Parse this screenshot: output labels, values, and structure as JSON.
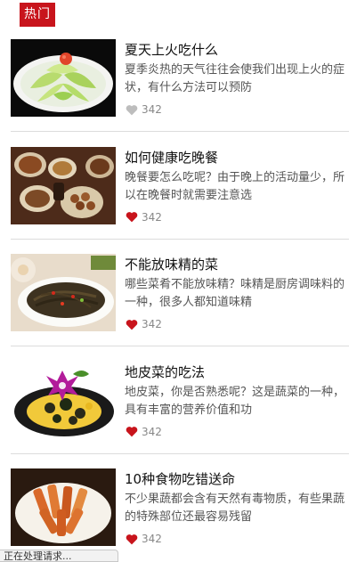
{
  "tab": {
    "label": "热门"
  },
  "articles": [
    {
      "title": "夏天上火吃什么",
      "desc": "夏季炎热的天气往往会使我们出现上火的症状，有什么方法可以预防",
      "likes": "342",
      "liked": false
    },
    {
      "title": "如何健康吃晚餐",
      "desc": "晚餐要怎么吃呢？由于晚上的活动量少，所以在晚餐时就需要注意选",
      "likes": "342",
      "liked": true
    },
    {
      "title": "不能放味精的菜",
      "desc": "哪些菜肴不能放味精？味精是厨房调味料的一种，很多人都知道味精",
      "likes": "342",
      "liked": true
    },
    {
      "title": "地皮菜的吃法",
      "desc": "地皮菜，你是否熟悉呢？这是蔬菜的一种，具有丰富的营养价值和功",
      "likes": "342",
      "liked": true
    },
    {
      "title": "10种食物吃错送命",
      "desc": "不少果蔬都会含有天然有毒物质，有些果蔬的特殊部位还最容易残留",
      "likes": "342",
      "liked": true
    }
  ],
  "status": {
    "text": "正在处理请求..."
  },
  "colors": {
    "accent": "#c8141c",
    "heart_active": "#c8141c",
    "heart_inactive": "#bdbdbd"
  }
}
